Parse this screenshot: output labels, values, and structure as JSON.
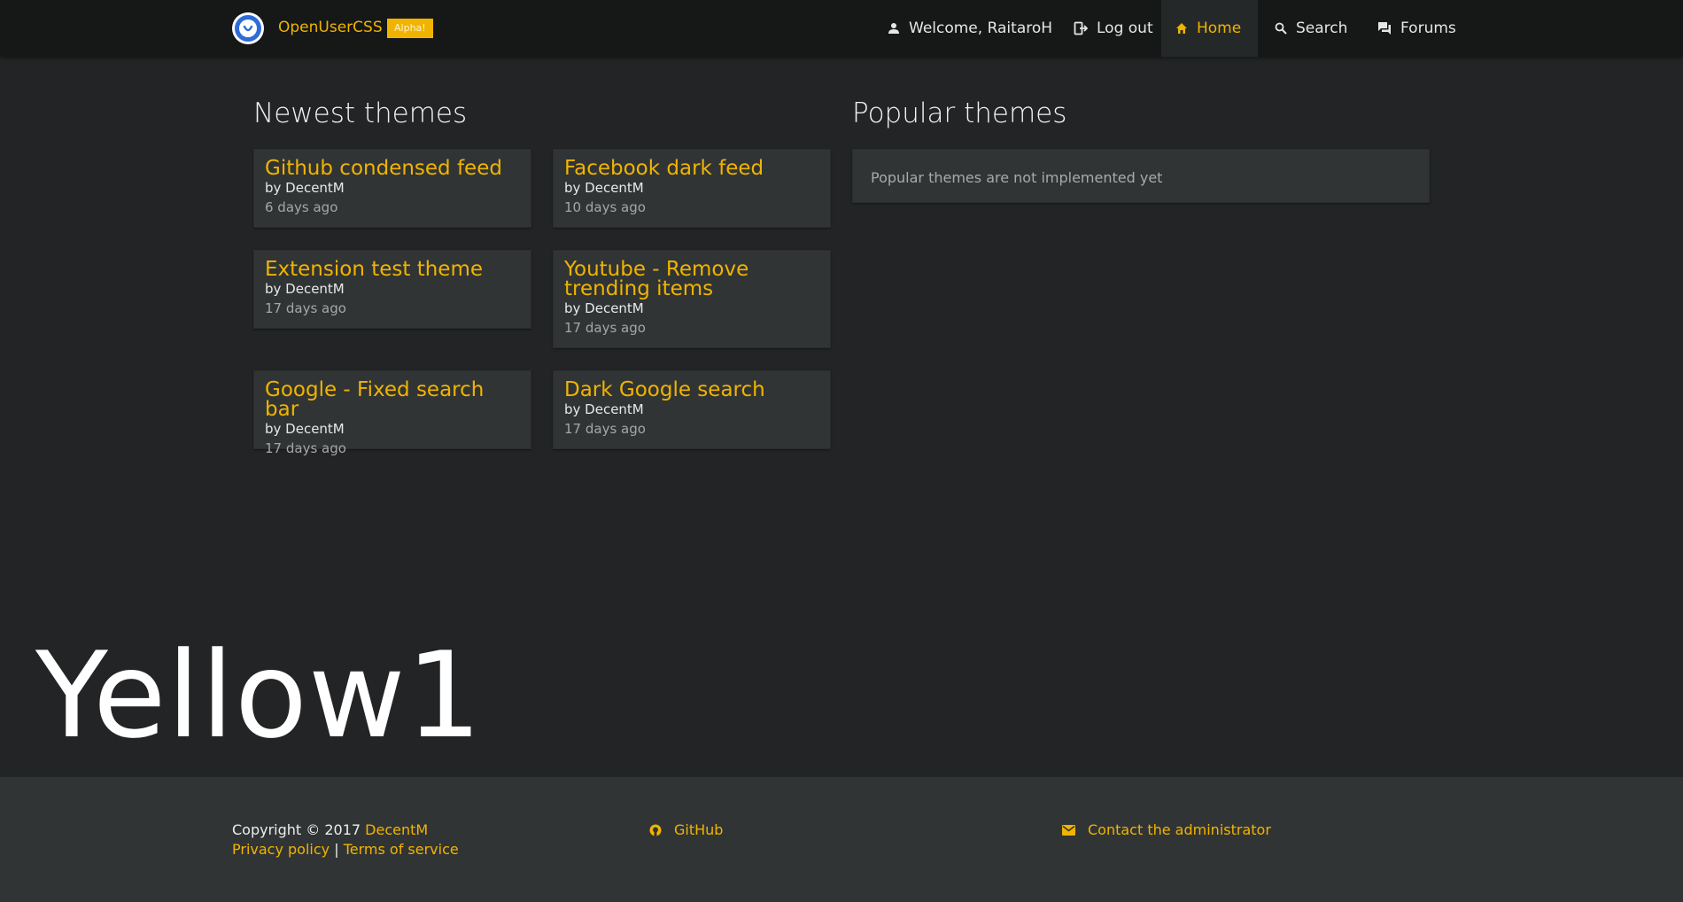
{
  "nav": {
    "brand": "OpenUserCSS",
    "badge": "Alpha!",
    "items": [
      {
        "label": "Welcome, RaitaroH",
        "icon": "person-icon"
      },
      {
        "label": "Log out",
        "icon": "logout-icon"
      },
      {
        "label": "Home",
        "icon": "home-icon",
        "active": true
      },
      {
        "label": "Search",
        "icon": "search-icon"
      },
      {
        "label": "Forums",
        "icon": "forum-icon"
      }
    ]
  },
  "newest": {
    "title": "Newest themes",
    "themes": [
      {
        "title": "Github condensed feed",
        "author": "by DecentM",
        "date": "6 days ago"
      },
      {
        "title": "Facebook dark feed",
        "author": "by DecentM",
        "date": "10 days ago"
      },
      {
        "title": "Extension test theme",
        "author": "by DecentM",
        "date": "17 days ago"
      },
      {
        "title": "Youtube - Remove trending items",
        "author": "by DecentM",
        "date": "17 days ago"
      },
      {
        "title": "Google - Fixed search bar",
        "author": "by DecentM",
        "date": "17 days ago"
      },
      {
        "title": "Dark Google search",
        "author": "by DecentM",
        "date": "17 days ago"
      }
    ]
  },
  "popular": {
    "title": "Popular themes",
    "message": "Popular themes are not implemented yet"
  },
  "watermark": "Yellow1",
  "footer": {
    "copyright": "Copyright © 2017",
    "author_link": "DecentM",
    "privacy": "Privacy policy",
    "separator": "|",
    "terms": "Terms of service",
    "github": "GitHub",
    "contact": "Contact the administrator"
  },
  "colors": {
    "accent": "#f0b400",
    "background": "#222425",
    "navbar": "#161818",
    "card": "#313435"
  }
}
